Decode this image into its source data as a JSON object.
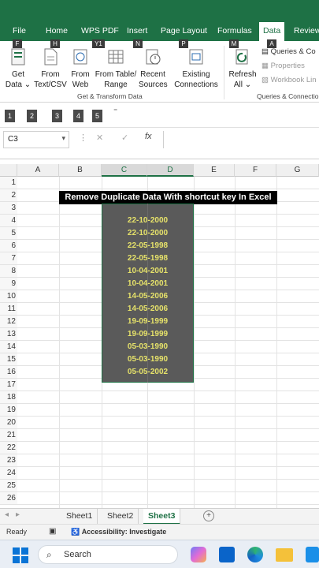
{
  "ribbon_tabs": [
    "File",
    "Home",
    "WPS PDF",
    "Insert",
    "Page Layout",
    "Formulas",
    "Data",
    "Review"
  ],
  "active_tab": "Data",
  "keytips": [
    "F",
    "H",
    "Y1",
    "N",
    "P",
    "M",
    "A"
  ],
  "ribbon": {
    "get_data": [
      "Get",
      "Data"
    ],
    "from_text": [
      "From",
      "Text/CSV"
    ],
    "from_web": [
      "From",
      "Web"
    ],
    "from_table": [
      "From Table/",
      "Range"
    ],
    "recent_sources": [
      "Recent",
      "Sources"
    ],
    "existing_connections": [
      "Existing",
      "Connections"
    ],
    "group_get_transform": "Get & Transform Data",
    "refresh_all": [
      "Refresh",
      "All"
    ],
    "queries_connections": "Queries & Co",
    "properties": "Properties",
    "workbook_links": "Workbook Lin",
    "group_queries": "Queries & Connectio"
  },
  "qat": [
    "1",
    "2",
    "3",
    "4",
    "5"
  ],
  "formula_bar": {
    "name_box": "C3",
    "cancel": "✕",
    "enter": "✓",
    "fx": "fx"
  },
  "columns": [
    "A",
    "B",
    "C",
    "D",
    "E",
    "F",
    "G"
  ],
  "rows": [
    "1",
    "2",
    "3",
    "4",
    "5",
    "6",
    "7",
    "8",
    "9",
    "10",
    "11",
    "12",
    "13",
    "14",
    "15",
    "16",
    "17",
    "18",
    "19",
    "20",
    "21",
    "22",
    "23",
    "24",
    "25",
    "26"
  ],
  "title_text": "Remove Duplicate Data With shortcut key In Excel",
  "dates": [
    "22-10-2000",
    "22-10-2000",
    "22-05-1998",
    "22-05-1998",
    "10-04-2001",
    "10-04-2001",
    "14-05-2006",
    "14-05-2006",
    "19-09-1999",
    "19-09-1999",
    "05-03-1990",
    "05-03-1990",
    "05-05-2002"
  ],
  "sheets": [
    "Sheet1",
    "Sheet2",
    "Sheet3"
  ],
  "active_sheet": "Sheet3",
  "add_sheet": "+",
  "status": {
    "ready": "Ready",
    "accessibility": "Accessibility: Investigate"
  },
  "taskbar": {
    "search": "Search"
  },
  "colors": {
    "excel_green": "#1e7145",
    "date_text": "#e6e26a",
    "selection_fill": "#5a5a5a"
  }
}
